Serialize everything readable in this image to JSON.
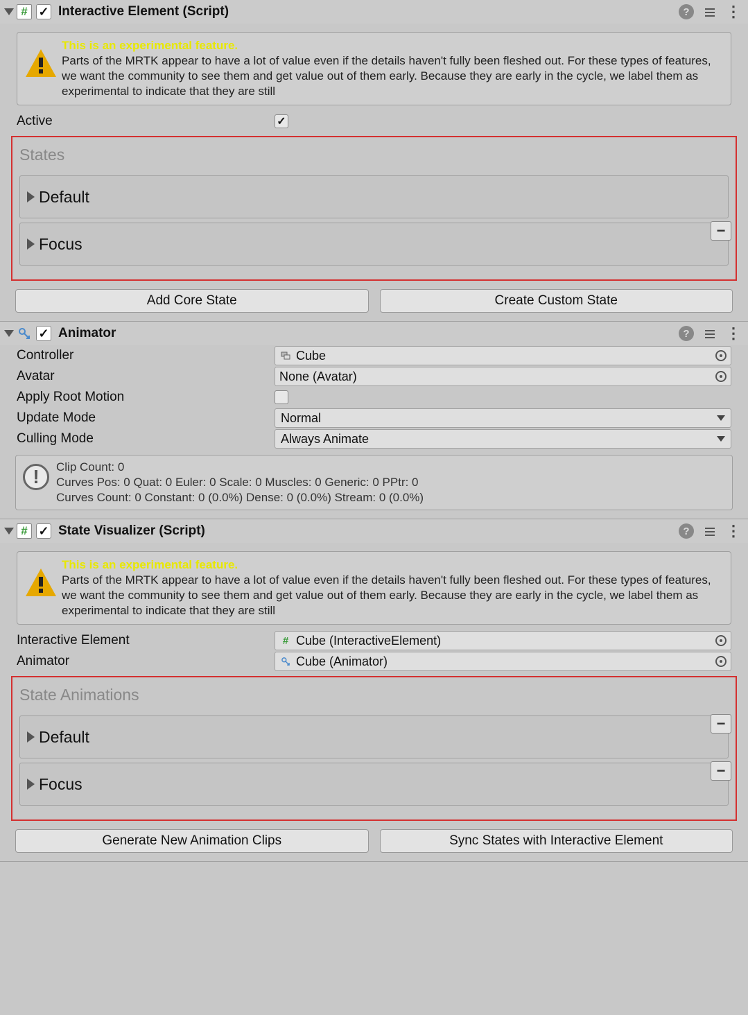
{
  "interactiveElement": {
    "title": "Interactive Element (Script)",
    "experimental": {
      "heading": "This is an experimental feature.",
      "body": "Parts of the MRTK appear to have a lot of value even if the details haven't fully been fleshed out. For these types of features, we want the community to see them and get value out of them early. Because they are early in the cycle, we label them as experimental to indicate that they are still"
    },
    "activeLabel": "Active",
    "statesTitle": "States",
    "states": [
      "Default",
      "Focus"
    ],
    "addCoreState": "Add Core State",
    "createCustomState": "Create Custom State"
  },
  "animator": {
    "title": "Animator",
    "controllerLabel": "Controller",
    "controllerValue": "Cube",
    "avatarLabel": "Avatar",
    "avatarValue": "None (Avatar)",
    "applyRootMotionLabel": "Apply Root Motion",
    "updateModeLabel": "Update Mode",
    "updateModeValue": "Normal",
    "cullingModeLabel": "Culling Mode",
    "cullingModeValue": "Always Animate",
    "stats": {
      "line1": "Clip Count: 0",
      "line2": "Curves Pos: 0 Quat: 0 Euler: 0 Scale: 0 Muscles: 0 Generic: 0 PPtr: 0",
      "line3": "Curves Count: 0 Constant: 0 (0.0%) Dense: 0 (0.0%) Stream: 0 (0.0%)"
    }
  },
  "stateVisualizer": {
    "title": "State Visualizer (Script)",
    "experimental": {
      "heading": "This is an experimental feature.",
      "body": "Parts of the MRTK appear to have a lot of value even if the details haven't fully been fleshed out. For these types of features, we want the community to see them and get value out of them early. Because they are early in the cycle, we label them as experimental to indicate that they are still"
    },
    "interactiveElementLabel": "Interactive Element",
    "interactiveElementValue": "Cube (InteractiveElement)",
    "animatorLabel": "Animator",
    "animatorValue": "Cube (Animator)",
    "stateAnimationsTitle": "State Animations",
    "states": [
      "Default",
      "Focus"
    ],
    "generateClips": "Generate New Animation Clips",
    "syncStates": "Sync States with Interactive Element"
  }
}
